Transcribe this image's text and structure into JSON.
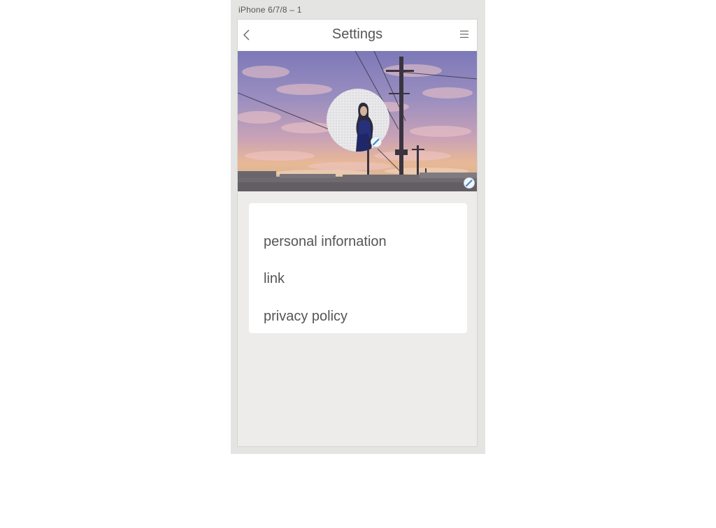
{
  "artboard": {
    "label": "iPhone 6/7/8 – 1"
  },
  "nav": {
    "title": "Settings",
    "back_icon": "chevron-left-icon",
    "menu_icon": "hamburger-menu-icon"
  },
  "profile": {
    "cover_icon": "sunset-cover-photo",
    "avatar_icon": "profile-avatar",
    "edit_icon": "pencil-icon"
  },
  "settings_menu": {
    "items": [
      {
        "label": "personal infornation"
      },
      {
        "label": "link"
      },
      {
        "label": "privacy policy"
      }
    ]
  },
  "colors": {
    "screen_bg": "#edecea",
    "text": "#555555",
    "edit_accent": "#3a8fd6"
  }
}
